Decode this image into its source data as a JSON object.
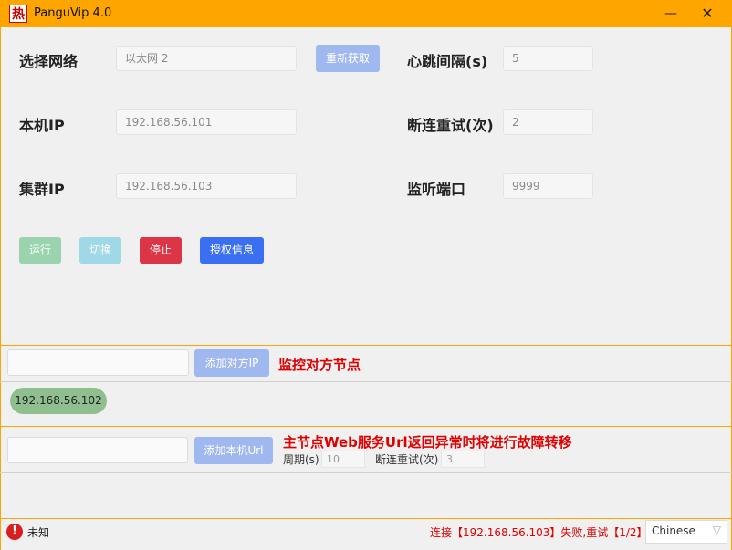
{
  "window": {
    "icon_glyph": "热",
    "title": "PanguVip 4.0",
    "minimize_glyph": "—",
    "close_glyph": "✕"
  },
  "form": {
    "network_label": "选择网络",
    "network_value": "以太网 2",
    "refresh_button": "重新获取",
    "heartbeat_label": "心跳间隔(s)",
    "heartbeat_value": "5",
    "local_ip_label": "本机IP",
    "local_ip_value": "192.168.56.101",
    "retry_label": "断连重试(次)",
    "retry_value": "2",
    "cluster_ip_label": "集群IP",
    "cluster_ip_value": "192.168.56.103",
    "listen_port_label": "监听端口",
    "listen_port_value": "9999"
  },
  "actions": {
    "run": "运行",
    "switch": "切换",
    "stop": "停止",
    "license": "授权信息"
  },
  "peer": {
    "input_value": "",
    "add_button": "添加对方IP",
    "note": "监控对方节点",
    "tags": [
      "192.168.56.102"
    ]
  },
  "local_url": {
    "input_value": "",
    "add_button": "添加本机Url",
    "note": "主节点Web服务Url返回异常时将进行故障转移",
    "period_label": "周期(s)",
    "period_value": "10",
    "retry_label": "断连重试(次)",
    "retry_value": "3"
  },
  "status": {
    "icon": "error-icon",
    "state": "未知",
    "message": "连接【192.168.56.103】失败,重试【1/2】",
    "language": "Chinese"
  },
  "colors": {
    "accent": "#ffa500",
    "primary_light": "#a0b8f0",
    "success_light": "#9ad4ae",
    "info_light": "#9fd8e6",
    "danger": "#dc3545",
    "primary": "#3a6ff2",
    "tag": "#8fbf8f",
    "note_red": "#e00000"
  }
}
